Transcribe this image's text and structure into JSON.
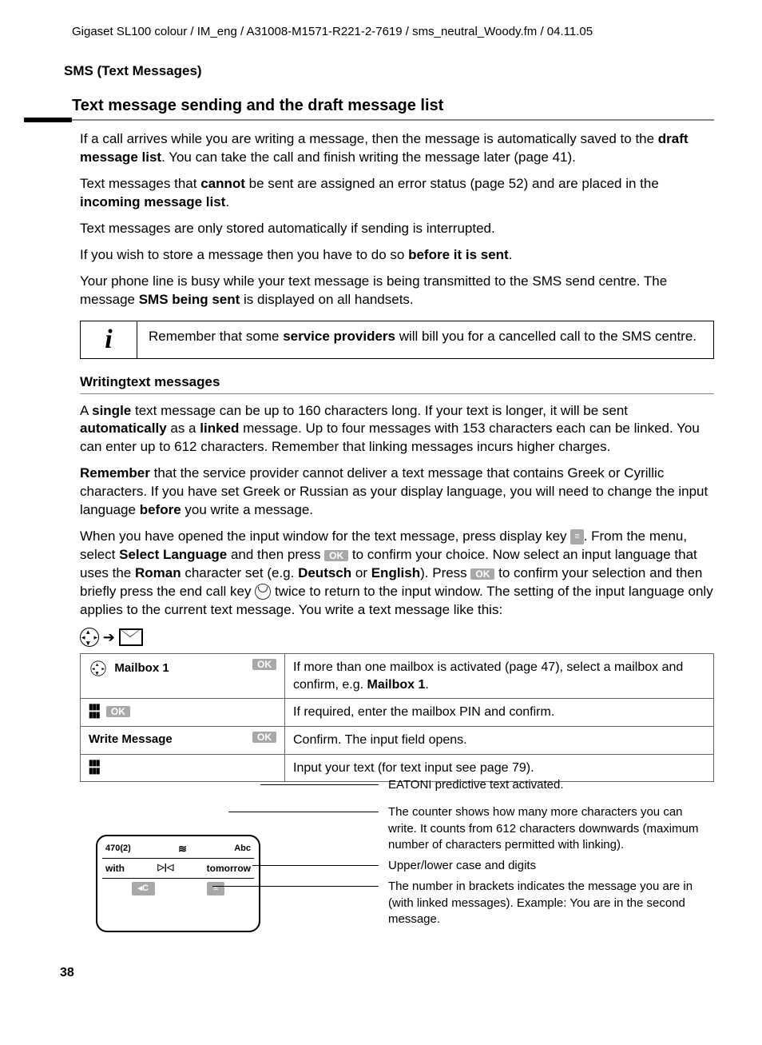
{
  "header": "Gigaset SL100 colour / IM_eng / A31008-M1571-R221-2-7619 / sms_neutral_Woody.fm / 04.11.05",
  "section": "SMS (Text Messages)",
  "h1": "Text message sending and the draft message list",
  "p1a": "If a call arrives while you are writing a message, then the message is automatically saved to the ",
  "p1b": "draft message list",
  "p1c": ". You can take the call and finish writing the message later (page 41).",
  "p2a": "Text messages that ",
  "p2b": "cannot",
  "p2c": " be sent are assigned an error status (page 52) and are placed in the ",
  "p2d": "incoming message list",
  "p2e": ".",
  "p3": "Text messages are only stored automatically if sending is interrupted.",
  "p4a": "If you wish to store a message then you have to do so ",
  "p4b": "before it is sent",
  "p4c": ".",
  "p5a": "Your phone line is busy while your text message is being transmitted to the SMS send centre. The message ",
  "p5b": "SMS being sent",
  "p5c": " is displayed on all handsets.",
  "info_a": "Remember that some ",
  "info_b": "service providers",
  "info_c": " will bill you for a cancelled call to the SMS centre.",
  "h2": "Writingtext messages",
  "q1a": "A ",
  "q1b": "single",
  "q1c": " text message can be up to 160 characters long. If your text is longer, it will be sent ",
  "q1d": "automatically",
  "q1e": " as a ",
  "q1f": "linked",
  "q1g": " message. Up to four messages with 153 characters each can be linked. You can enter up to 612 characters. Remember that linking messages incurs higher charges.",
  "q2a": "Remember",
  "q2b": " that the service provider cannot deliver a text message that contains Greek or Cyrillic characters. If you have set Greek or Russian as your display language, you will need to change the input language ",
  "q2c": "before",
  "q2d": " you write a message.",
  "q3a": "When you have opened the input window for the text message, press display key ",
  "q3b": ". From the menu, select ",
  "q3c": "Select Language",
  "q3d": " and then press ",
  "q3e": " to confirm your choice. Now select an input language that uses the ",
  "q3f": "Roman",
  "q3g": " character set (e.g. ",
  "q3h": "Deutsch",
  "q3i": " or ",
  "q3j": "English",
  "q3k": "). Press ",
  "q3l": " to confirm your selection and then briefly press the end call key ",
  "q3m": " twice to return to the input window. The setting of the input language only applies to the current text message. You write a text message like this:",
  "ok": "OK",
  "step1_label": "Mailbox 1",
  "step1_desc_a": "If more than one mailbox is activated (page 47), select a mailbox and confirm, e.g. ",
  "step1_desc_b": "Mailbox 1",
  "step1_desc_c": ".",
  "step2_desc": "If required, enter the mailbox PIN and confirm.",
  "step3_label": "Write Message",
  "step3_desc": "Confirm. The input field opens.",
  "step4_desc": "Input your text (for text input see page 79).",
  "annot1": "EATONI predictive text activated.",
  "annot2": "The counter shows how many more characters you can write. It counts from 612 characters downwards (maximum number of characters permitted with linking).",
  "annot3": "Upper/lower case and digits",
  "annot4": "The number in brackets indicates the message you are in (with linked messages). Example: You are in the second message.",
  "phone_counter": "470(2)",
  "phone_mode": "Abc",
  "phone_with": "with",
  "phone_tomorrow": "tomorrow",
  "phone_c": "C",
  "page": "38"
}
